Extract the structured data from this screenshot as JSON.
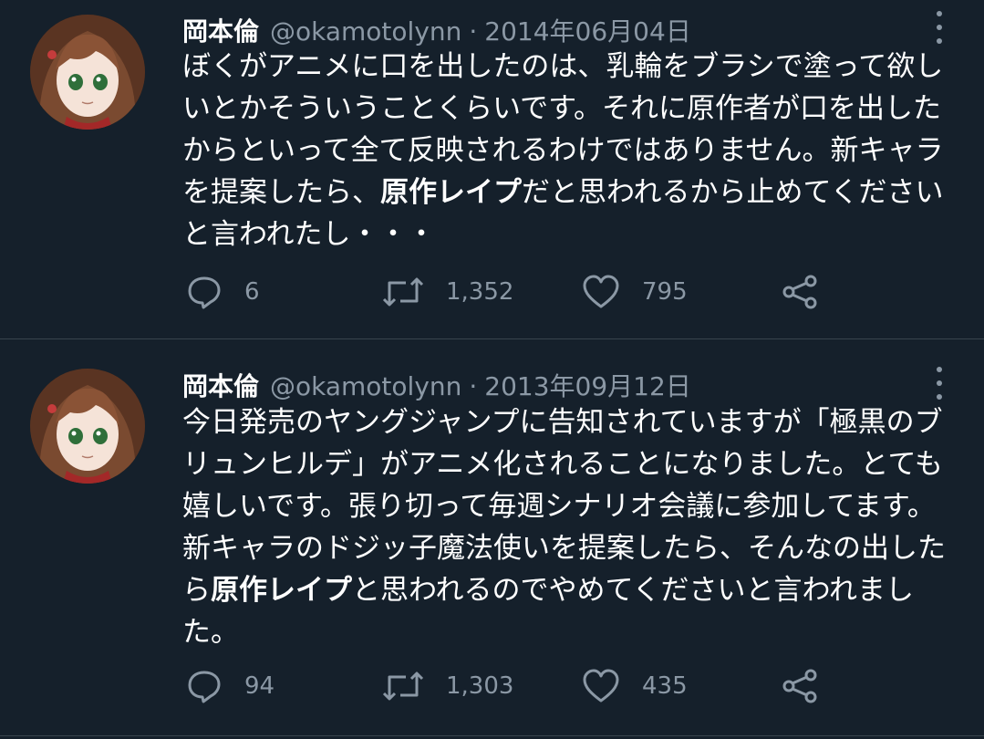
{
  "tweets": [
    {
      "author_name": "岡本倫",
      "handle": "@okamotolynn",
      "separator": "·",
      "date": "2014年06月04日",
      "text_before": "ぼくがアニメに口を出したのは、乳輪をブラシで塗って欲しいとかそういうことくらいです。それに原作者が口を出したからといって全て反映されるわけではありません。新キャラを提案したら、",
      "text_bold": "原作レイプ",
      "text_after": "だと思われるから止めてくださいと言われたし・・・",
      "replies": "6",
      "retweets": "1,352",
      "likes": "795"
    },
    {
      "author_name": "岡本倫",
      "handle": "@okamotolynn",
      "separator": "·",
      "date": "2013年09月12日",
      "text_before": "今日発売のヤングジャンプに告知されていますが「極黒のブリュンヒルデ」がアニメ化されることになりました。とても嬉しいです。張り切って毎週シナリオ会議に参加してます。新キャラのドジッ子魔法使いを提案したら、そんなの出したら",
      "text_bold": "原作レイプ",
      "text_after": "と思われるのでやめてくださいと言われました。",
      "replies": "94",
      "retweets": "1,303",
      "likes": "435"
    }
  ],
  "icons": {
    "reply": "speech-bubble-icon",
    "retweet": "retweet-arrows-icon",
    "like": "heart-icon",
    "share": "share-nodes-icon",
    "more": "vertical-dots-icon",
    "avatar": "anime-girl-avatar"
  },
  "colors": {
    "background": "#15202b",
    "text": "#ffffff",
    "muted": "#8b98a5",
    "divider": "#38444d"
  }
}
